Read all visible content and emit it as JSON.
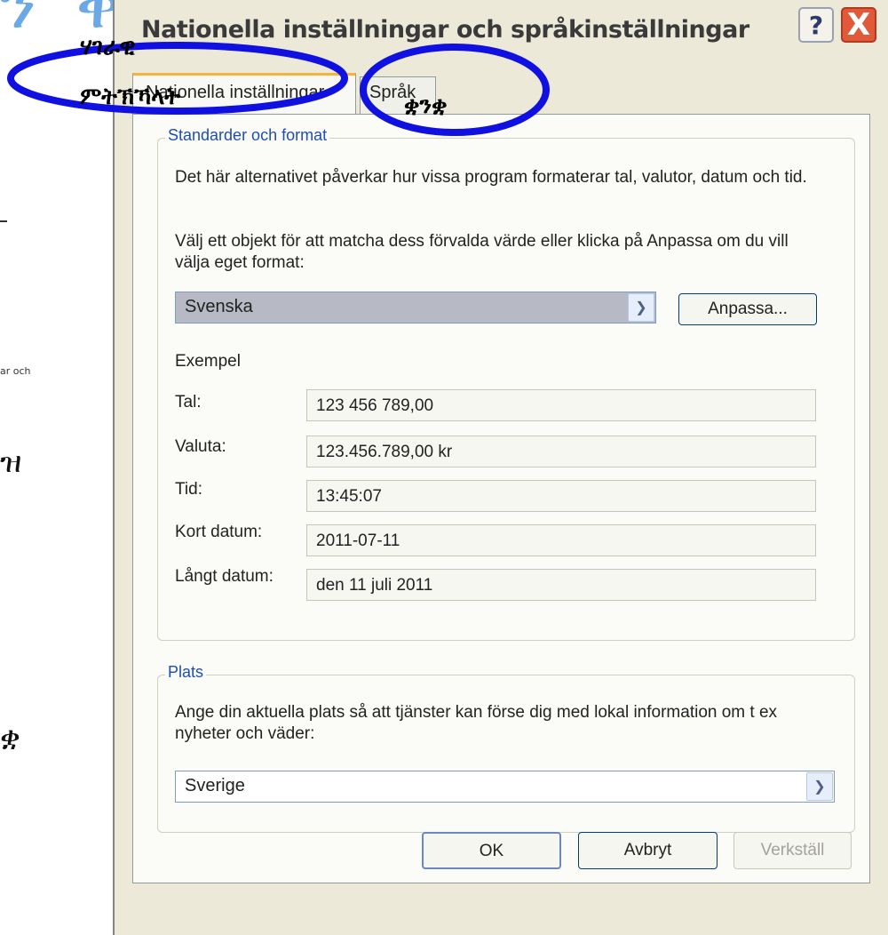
{
  "background": {
    "big_glyphs": "ን ቕተር",
    "small_text": "ar och",
    "glyph_1": "ዝ",
    "glyph_2": "ቋ"
  },
  "window": {
    "title": "Nationella inställningar och språkinställningar",
    "help_label": "?",
    "close_label": "X"
  },
  "tabs": [
    {
      "label": "Nationella inställningar"
    },
    {
      "label": "Språk"
    }
  ],
  "standards": {
    "group_title": "Standarder och format",
    "description": "Det här alternativet påverkar hur vissa program formaterar tal, valutor, datum och tid.",
    "instruction": "Välj ett objekt för att matcha dess förvalda värde eller klicka på Anpassa om du vill välja eget format:",
    "selected_locale": "Svenska",
    "customize_label": "Anpassa...",
    "examples_heading": "Exempel",
    "examples": [
      {
        "label": "Tal:",
        "value": "123 456 789,00"
      },
      {
        "label": "Valuta:",
        "value": "123.456.789,00 kr"
      },
      {
        "label": "Tid:",
        "value": "13:45:07"
      },
      {
        "label": "Kort datum:",
        "value": "2011-07-11"
      },
      {
        "label": "Långt datum:",
        "value": "den 11 juli 2011"
      }
    ]
  },
  "location": {
    "group_title": "Plats",
    "description": "Ange din aktuella plats så att tjänster kan förse dig med lokal information om t ex nyheter och väder:",
    "selected": "Sverige"
  },
  "buttons": {
    "ok": "OK",
    "cancel": "Avbryt",
    "apply": "Verkställ"
  },
  "annotations": {
    "regional_line1": "ሃገራዊ",
    "regional_line2": "ምትኽኻላት",
    "language": "ቋንቋ",
    "color": "#1010e0"
  }
}
